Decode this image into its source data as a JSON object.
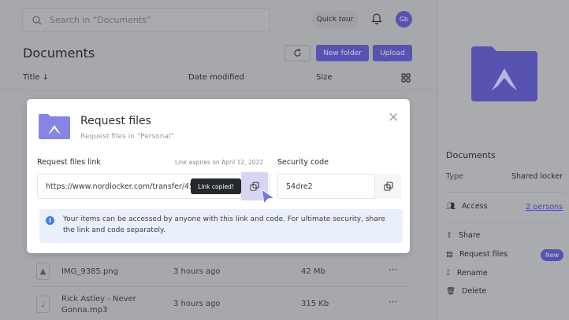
{
  "header": {
    "search_placeholder": "Search in “Documents”",
    "quick_tour": "Quick tour",
    "avatar_initials": "Gb"
  },
  "page": {
    "title": "Documents",
    "new_folder": "New folder",
    "upload": "Upload"
  },
  "columns": {
    "title": "Title ↓",
    "date": "Date modified",
    "size": "Size"
  },
  "files": [
    {
      "name": "IMG_9385.png",
      "date": "3 hours ago",
      "size": "42 Mb",
      "icon": "image-icon"
    },
    {
      "name": "Rick Astley - Never Gonna.mp3",
      "date": "3 hours ago",
      "size": "315 Kb",
      "icon": "music-note-icon"
    }
  ],
  "modal": {
    "title": "Request files",
    "subtitle": "Request files in “Personal”",
    "link_label": "Request files link",
    "expires": "Link expires on April 12, 2022",
    "link_value": "https://www.nordlocker.com/transfer/45",
    "tooltip": "Link copied!",
    "code_label": "Security code",
    "code_value": "54dre2",
    "info": "Your items can be accessed by anyone with this link and code. For ultimate security, share the link and code separately."
  },
  "sidebar": {
    "title": "Documents",
    "type_label": "Type",
    "type_value": "Shared locker",
    "access_label": "Access",
    "access_value": "2 persons",
    "actions": [
      {
        "label": "Share"
      },
      {
        "label": "Request files",
        "badge": "New"
      },
      {
        "label": "Rename"
      },
      {
        "label": "Delete"
      }
    ]
  },
  "colors": {
    "accent": "#6c63d6",
    "overlay_accent": "#5853b0",
    "info_bg": "#eaf0fb"
  }
}
